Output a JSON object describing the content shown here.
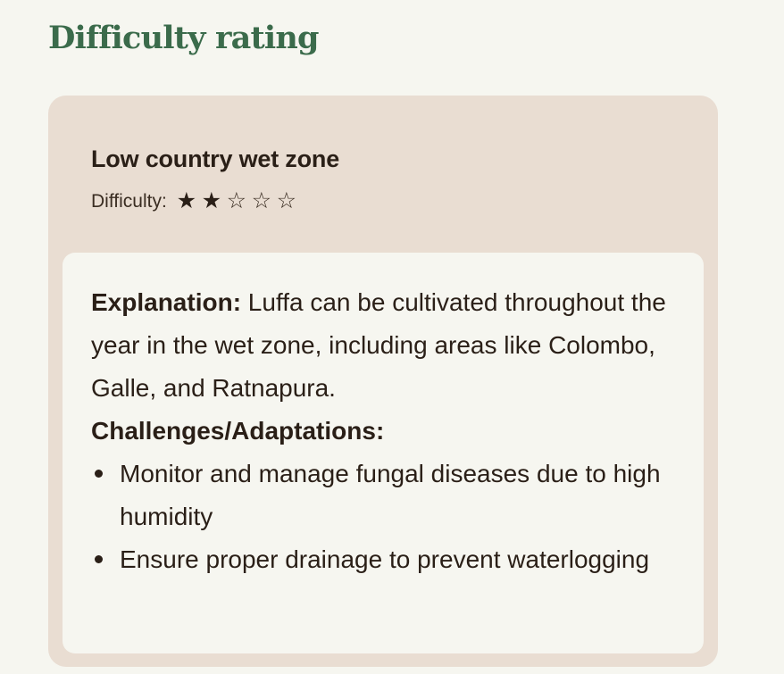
{
  "section": {
    "title": "Difficulty rating"
  },
  "zone": {
    "title": "Low country wet zone",
    "difficulty_label": "Difficulty:",
    "rating": {
      "value": 2,
      "max": 5
    }
  },
  "details": {
    "explanation_label": "Explanation:",
    "explanation_text": " Luffa can be cultivated throughout the year in the wet zone, including areas like Colombo, Galle, and Ratnapura.",
    "challenges_label": "Challenges/Adaptations:",
    "challenges": [
      "Monitor and manage fungal diseases due to high humidity",
      "Ensure proper drainage to prevent waterlogging"
    ]
  },
  "colors": {
    "title_green": "#3b6b4b",
    "card_bg": "#e9ddd2",
    "inner_bg": "#f6f6f0",
    "text": "#2a1f17"
  }
}
